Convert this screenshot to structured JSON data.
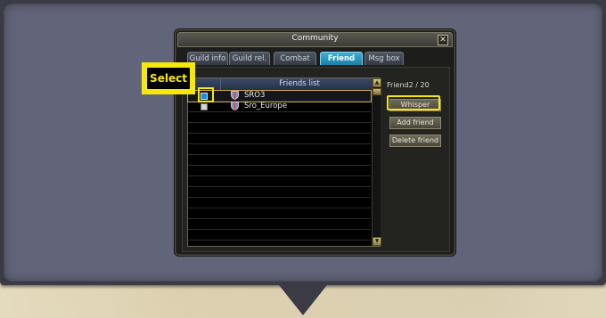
{
  "window": {
    "title": "Community",
    "close_label": "✕"
  },
  "tabs": [
    {
      "label": "Guild info",
      "active": false
    },
    {
      "label": "Guild rel.",
      "active": false
    },
    {
      "label": "Combat",
      "active": false
    },
    {
      "label": "Friend",
      "active": true
    },
    {
      "label": "Msg box",
      "active": false
    }
  ],
  "friends_list": {
    "header": "Friends list",
    "rows": [
      {
        "name": "SRO3",
        "selected": true
      },
      {
        "name": "Sro_Europe",
        "selected": false
      }
    ]
  },
  "friend_count": "Friend2 / 20",
  "buttons": {
    "whisper": "Whisper",
    "add_friend": "Add friend",
    "delete_friend": "Delete friend"
  },
  "callout": {
    "label": "Select"
  },
  "colors": {
    "highlight": "#f6e70c",
    "active_tab": "#3db1d4",
    "frame": "#626479"
  },
  "icons": {
    "guild_emblem": "shield-icon",
    "scroll_up": "arrow-up-icon",
    "scroll_down": "arrow-down-icon",
    "flow_arrow": "arrow-down-icon"
  }
}
